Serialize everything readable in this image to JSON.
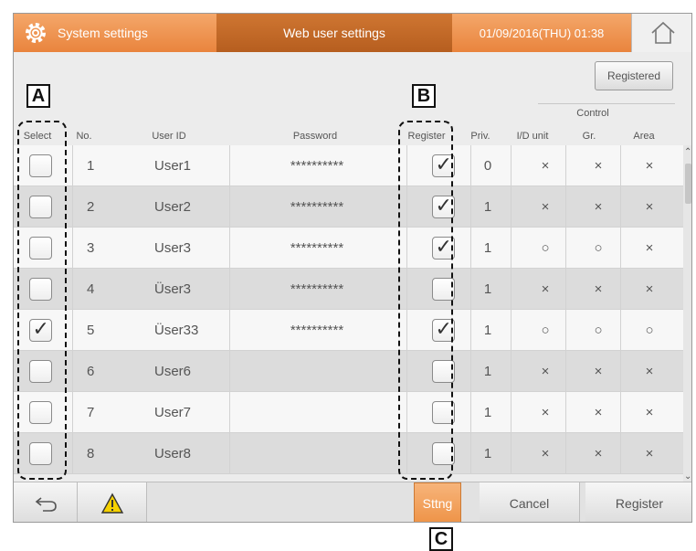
{
  "header": {
    "system_settings": "System settings",
    "web_user_settings": "Web user settings",
    "datetime": "01/09/2016(THU) 01:38"
  },
  "buttons": {
    "registered": "Registered",
    "sttng": "Sttng",
    "cancel": "Cancel",
    "register": "Register"
  },
  "table": {
    "control_group_label": "Control",
    "columns": {
      "select": "Select",
      "no": "No.",
      "user_id": "User ID",
      "password": "Password",
      "register": "Register",
      "priv": "Priv.",
      "id_unit": "I/D unit",
      "gr": "Gr.",
      "area": "Area"
    },
    "rows": [
      {
        "no": "1",
        "user_id": "User1",
        "password": "**********",
        "select": false,
        "register": true,
        "priv": "0",
        "id_unit": "×",
        "gr": "×",
        "area": "×"
      },
      {
        "no": "2",
        "user_id": "User2",
        "password": "**********",
        "select": false,
        "register": true,
        "priv": "1",
        "id_unit": "×",
        "gr": "×",
        "area": "×"
      },
      {
        "no": "3",
        "user_id": "User3",
        "password": "**********",
        "select": false,
        "register": true,
        "priv": "1",
        "id_unit": "○",
        "gr": "○",
        "area": "×"
      },
      {
        "no": "4",
        "user_id": "Üser3",
        "password": "**********",
        "select": false,
        "register": false,
        "priv": "1",
        "id_unit": "×",
        "gr": "×",
        "area": "×"
      },
      {
        "no": "5",
        "user_id": "Üser33",
        "password": "**********",
        "select": true,
        "register": true,
        "priv": "1",
        "id_unit": "○",
        "gr": "○",
        "area": "○"
      },
      {
        "no": "6",
        "user_id": "User6",
        "password": "",
        "select": false,
        "register": false,
        "priv": "1",
        "id_unit": "×",
        "gr": "×",
        "area": "×"
      },
      {
        "no": "7",
        "user_id": "User7",
        "password": "",
        "select": false,
        "register": false,
        "priv": "1",
        "id_unit": "×",
        "gr": "×",
        "area": "×"
      },
      {
        "no": "8",
        "user_id": "User8",
        "password": "",
        "select": false,
        "register": false,
        "priv": "1",
        "id_unit": "×",
        "gr": "×",
        "area": "×"
      }
    ]
  },
  "annotations": {
    "a": "A",
    "b": "B",
    "c": "C"
  },
  "icons": {
    "header": "gear-icon",
    "home": "home-icon",
    "back": "back-arrow-icon",
    "warning": "warning-icon"
  },
  "colors": {
    "header_orange": "#e9843d",
    "header_active": "#b65e1f",
    "sttng_button": "#ee9347",
    "warning_yellow": "#f5d100"
  }
}
